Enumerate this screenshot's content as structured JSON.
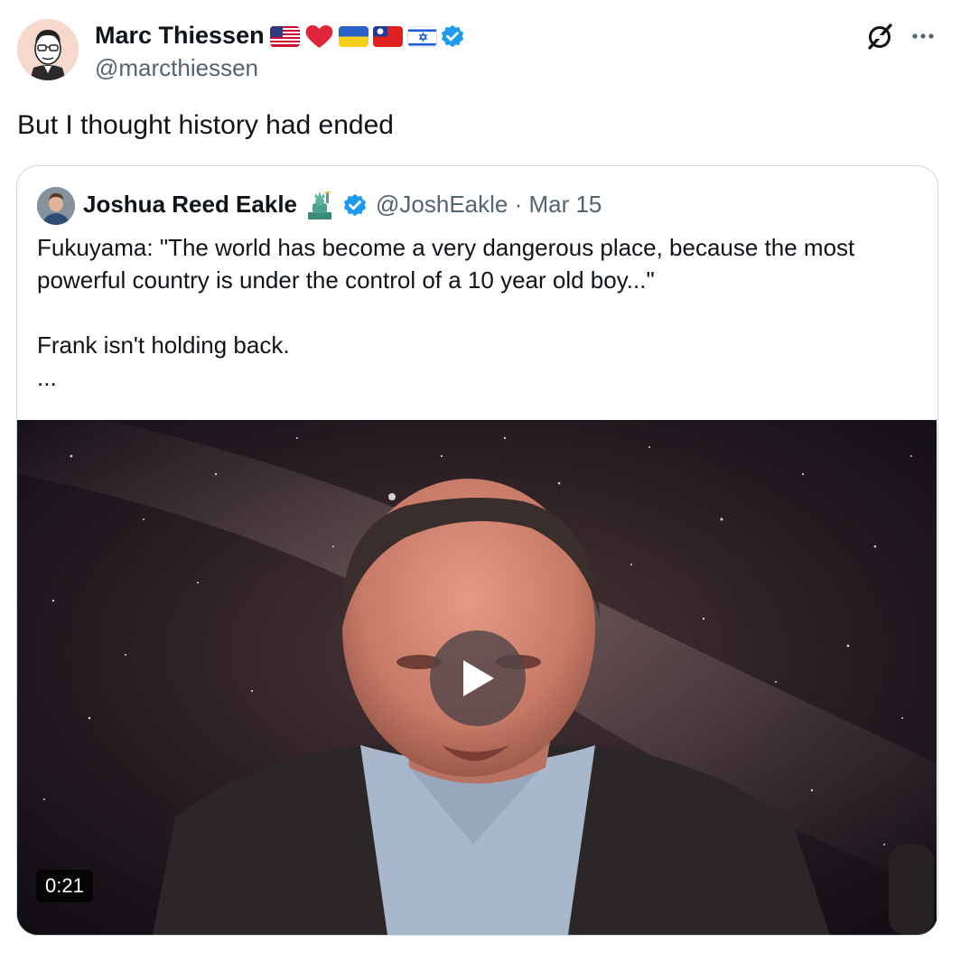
{
  "post": {
    "author_name": "Marc Thiessen",
    "author_handle": "@marcthiessen",
    "badges": [
      "us-flag",
      "red-heart",
      "ukraine-flag",
      "taiwan-flag",
      "israel-flag",
      "verified-badge"
    ],
    "text": "But I thought history had ended",
    "icons": {
      "grok": "grok-icon",
      "more": "more-icon"
    }
  },
  "quoted": {
    "author_name": "Joshua Reed Eakle",
    "badges": [
      "statue-of-liberty",
      "verified-badge"
    ],
    "meta": "@JoshEakle · Mar 15",
    "lines": [
      "Fukuyama: \"The world has become a very dangerous place, because the most",
      "powerful country is under the control of a 10 year old boy...\"",
      "",
      "Frank isn't holding back.",
      "..."
    ],
    "video": {
      "duration": "0:21",
      "play_icon": "play-icon"
    }
  },
  "colors": {
    "text_primary": "#0f1419",
    "text_secondary": "#536471",
    "verified": "#1d9bf0",
    "border": "#cfd9de"
  }
}
